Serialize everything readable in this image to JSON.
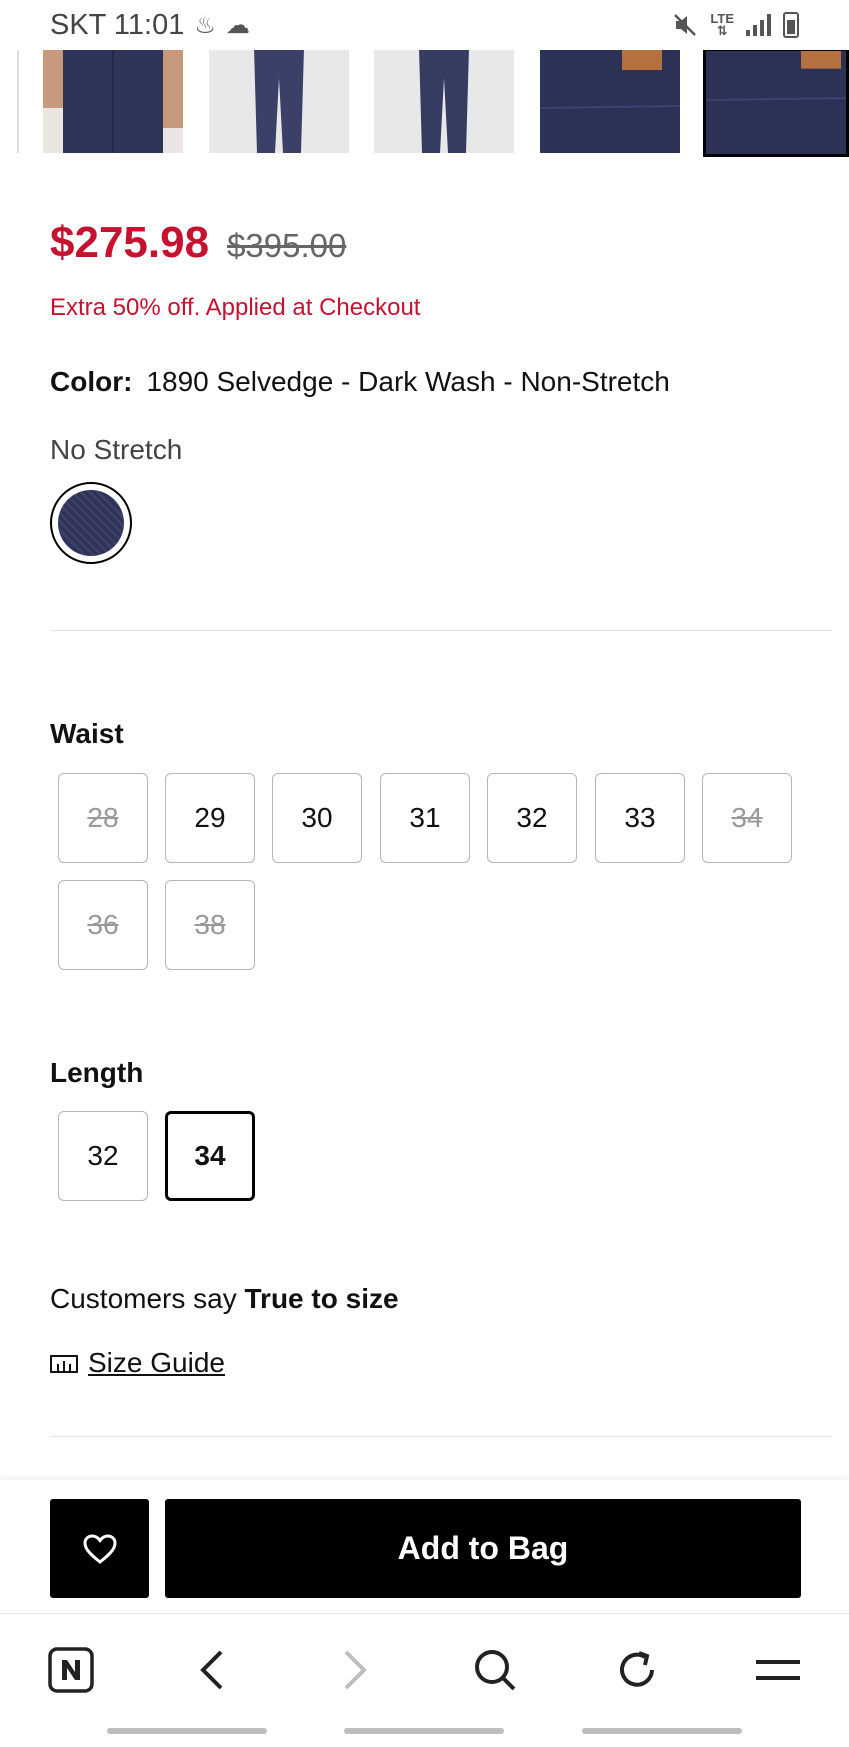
{
  "status_bar": {
    "carrier_time": "SKT 11:01",
    "network": "LTE"
  },
  "product": {
    "price_sale": "$275.98",
    "price_original": "$395.00",
    "promo": "Extra 50% off. Applied at Checkout",
    "color_label": "Color:",
    "color_value": "1890 Selvedge - Dark Wash - Non-Stretch",
    "stretch": "No Stretch"
  },
  "waist": {
    "label": "Waist",
    "options": [
      {
        "value": "28",
        "available": false
      },
      {
        "value": "29",
        "available": true
      },
      {
        "value": "30",
        "available": true
      },
      {
        "value": "31",
        "available": true
      },
      {
        "value": "32",
        "available": true
      },
      {
        "value": "33",
        "available": true
      },
      {
        "value": "34",
        "available": false
      },
      {
        "value": "36",
        "available": false
      },
      {
        "value": "38",
        "available": false
      }
    ]
  },
  "length": {
    "label": "Length",
    "options": [
      {
        "value": "32",
        "available": true,
        "selected": false
      },
      {
        "value": "34",
        "available": true,
        "selected": true
      }
    ]
  },
  "fit": {
    "prefix": "Customers say",
    "value": "True to size"
  },
  "size_guide": {
    "label": "Size Guide"
  },
  "actions": {
    "add_to_bag": "Add to Bag"
  },
  "colors": {
    "sale_red": "#c41230",
    "denim": "#2f3459",
    "black": "#000000"
  }
}
